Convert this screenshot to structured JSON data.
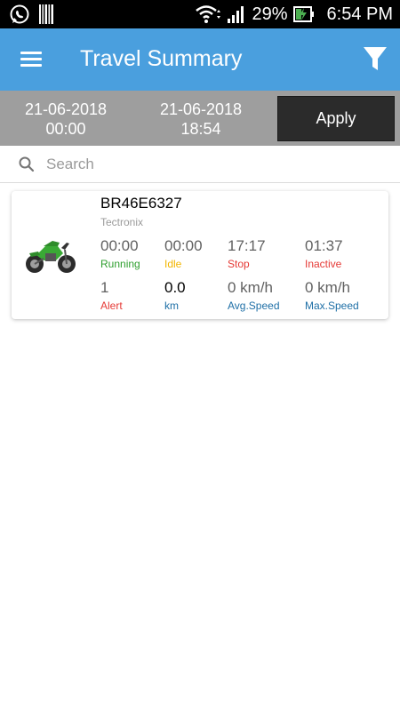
{
  "status_bar": {
    "battery": "29%",
    "time": "6:54 PM"
  },
  "app_bar": {
    "title": "Travel Summary",
    "menu_icon": "hamburger-menu-icon",
    "filter_icon": "filter-funnel-icon"
  },
  "date_range": {
    "from_date": "21-06-2018",
    "from_time": "00:00",
    "to_date": "21-06-2018",
    "to_time": "18:54",
    "apply_label": "Apply"
  },
  "search": {
    "placeholder": "Search"
  },
  "vehicles": [
    {
      "number": "BR46E6327",
      "company": "Tectronix",
      "icon": "motorcycle-icon",
      "stats": {
        "running": {
          "value": "00:00",
          "label": "Running",
          "color": "#2e9e2e"
        },
        "idle": {
          "value": "00:00",
          "label": "Idle",
          "color": "#f2b600"
        },
        "stop": {
          "value": "17:17",
          "label": "Stop",
          "color": "#e53935"
        },
        "inactive": {
          "value": "01:37",
          "label": "Inactive",
          "color": "#e53935"
        },
        "alert": {
          "value": "1",
          "label": "Alert",
          "color": "#e53935"
        },
        "km": {
          "value": "0.0",
          "label": "km",
          "color": "#1e6fa6"
        },
        "avg_speed": {
          "value": "0 km/h",
          "label": "Avg.Speed",
          "color": "#1e6fa6"
        },
        "max_speed": {
          "value": "0 km/h",
          "label": "Max.Speed",
          "color": "#1e6fa6"
        }
      }
    }
  ],
  "colors": {
    "app_bar": "#4a9fde",
    "date_bar": "#9e9e9e",
    "apply_button": "#2b2b2b"
  }
}
